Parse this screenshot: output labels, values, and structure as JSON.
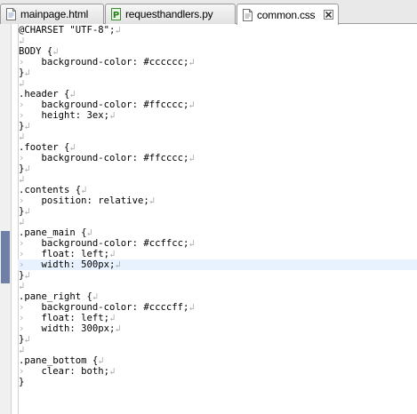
{
  "tabs": [
    {
      "label": "mainpage.html",
      "icon": "html-file-icon",
      "active": false
    },
    {
      "label": "requesthandlers.py",
      "icon": "python-file-icon",
      "active": false
    },
    {
      "label": "common.css",
      "icon": "css-file-icon",
      "active": true,
      "close": "close-icon"
    }
  ],
  "editor": {
    "whitespace_marker": "›",
    "newline_marker": "↲",
    "current_line": 23,
    "lines": [
      {
        "indent": false,
        "text": "@CHARSET \"UTF-8\";"
      },
      {
        "indent": false,
        "text": ""
      },
      {
        "indent": false,
        "text": "BODY {"
      },
      {
        "indent": true,
        "text": "background-color: #cccccc;"
      },
      {
        "indent": false,
        "text": "}"
      },
      {
        "indent": false,
        "text": ""
      },
      {
        "indent": false,
        "text": ".header {"
      },
      {
        "indent": true,
        "text": "background-color: #ffcccc;"
      },
      {
        "indent": true,
        "text": "height: 3ex;"
      },
      {
        "indent": false,
        "text": "}"
      },
      {
        "indent": false,
        "text": ""
      },
      {
        "indent": false,
        "text": ".footer {"
      },
      {
        "indent": true,
        "text": "background-color: #ffcccc;"
      },
      {
        "indent": false,
        "text": "}"
      },
      {
        "indent": false,
        "text": ""
      },
      {
        "indent": false,
        "text": ".contents {"
      },
      {
        "indent": true,
        "text": "position: relative;"
      },
      {
        "indent": false,
        "text": "}"
      },
      {
        "indent": false,
        "text": ""
      },
      {
        "indent": false,
        "text": ".pane_main {"
      },
      {
        "indent": true,
        "text": "background-color: #ccffcc;"
      },
      {
        "indent": true,
        "text": "float: left;"
      },
      {
        "indent": true,
        "text": "width: 500px;"
      },
      {
        "indent": false,
        "text": "}"
      },
      {
        "indent": false,
        "text": ""
      },
      {
        "indent": false,
        "text": ".pane_right {"
      },
      {
        "indent": true,
        "text": "background-color: #ccccff;"
      },
      {
        "indent": true,
        "text": "float: left;"
      },
      {
        "indent": true,
        "text": "width: 300px;"
      },
      {
        "indent": false,
        "text": "}"
      },
      {
        "indent": false,
        "text": ""
      },
      {
        "indent": false,
        "text": ".pane_bottom {"
      },
      {
        "indent": true,
        "text": "clear: both;"
      },
      {
        "indent": false,
        "text": "}",
        "no_newline": true
      }
    ]
  }
}
